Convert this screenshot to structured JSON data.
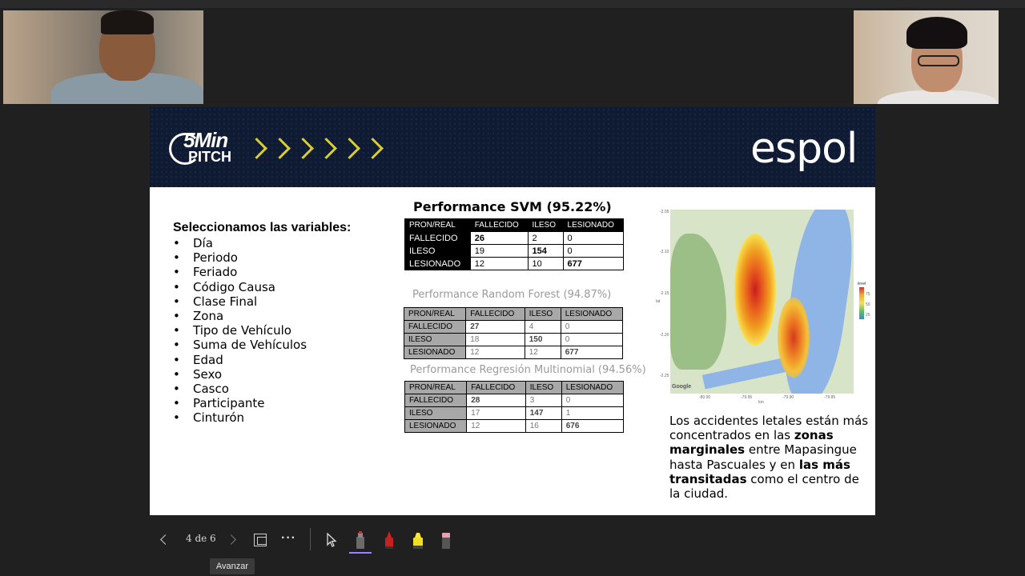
{
  "slide": {
    "brand_logo": "5Min PITCH",
    "brand_logo_big": "5Min",
    "brand_logo_small": "PITCH",
    "espol": "espol",
    "variables": {
      "title": "Seleccionamos las variables:",
      "items": [
        "Día",
        "Periodo",
        "Feriado",
        "Código Causa",
        "Clase Final",
        "Zona",
        "Tipo de Vehículo",
        "Suma de Vehículos",
        "Edad",
        "Sexo",
        "Casco",
        "Participante",
        "Cinturón"
      ]
    },
    "svm": {
      "title": "Performance SVM (95.22%)",
      "headers": [
        "PRON/REAL",
        "FALLECIDO",
        "ILESO",
        "LESIONADO"
      ],
      "rows": [
        {
          "label": "FALLECIDO",
          "values": [
            "26",
            "2",
            "0"
          ]
        },
        {
          "label": "ILESO",
          "values": [
            "19",
            "154",
            "0"
          ]
        },
        {
          "label": "LESIONADO",
          "values": [
            "12",
            "10",
            "677"
          ]
        }
      ]
    },
    "rf": {
      "title": "Performance Random Forest (94.87%)",
      "headers": [
        "PRON/REAL",
        "FALLECIDO",
        "ILESO",
        "LESIONADO"
      ],
      "rows": [
        {
          "label": "FALLECIDO",
          "values": [
            "27",
            "4",
            "0"
          ]
        },
        {
          "label": "ILESO",
          "values": [
            "18",
            "150",
            "0"
          ]
        },
        {
          "label": "LESIONADO",
          "values": [
            "12",
            "12",
            "677"
          ]
        }
      ]
    },
    "rm": {
      "title": "Performance Regresión Multinomial (94.56%)",
      "headers": [
        "PRON/REAL",
        "FALLECIDO",
        "ILESO",
        "LESIONADO"
      ],
      "rows": [
        {
          "label": "FALLECIDO",
          "values": [
            "28",
            "3",
            "0"
          ]
        },
        {
          "label": "ILESO",
          "values": [
            "17",
            "147",
            "1"
          ]
        },
        {
          "label": "LESIONADO",
          "values": [
            "12",
            "16",
            "676"
          ]
        }
      ]
    },
    "map": {
      "google": "Google",
      "legend_title": "level",
      "axis_x": [
        "-80.00",
        "-79.95",
        "-79.90",
        "-79.85"
      ],
      "axis_x_label": "lon",
      "axis_y": [
        "-2.05",
        "-2.10",
        "-2.15",
        "-2.20",
        "-2.25"
      ],
      "axis_y_label": "lat",
      "legend_values": [
        "75",
        "50",
        "25"
      ]
    },
    "description": {
      "p1": "Los accidentes letales están más concentrados en las ",
      "b1": "zonas marginales",
      "p2": " entre Mapasingue hasta Pascuales y en ",
      "b2": "las más transitadas",
      "p3": " como el centro de la ciudad."
    }
  },
  "toolbar": {
    "counter": "4 de 6",
    "more": "···",
    "tooltip": "Avanzar",
    "pen_colors": [
      "#888888",
      "#d42020",
      "#f0e020",
      "#e8a0b0"
    ]
  }
}
